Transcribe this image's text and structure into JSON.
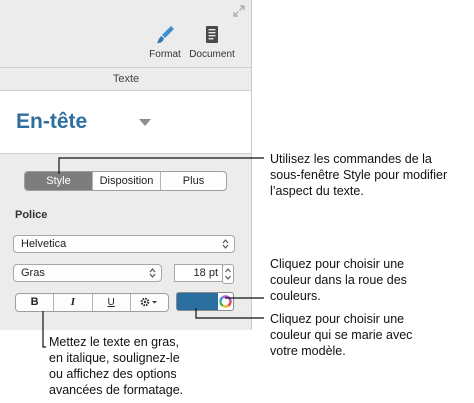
{
  "toolbar": {
    "format_label": "Format",
    "document_label": "Document",
    "format_icon": "paintbrush-icon",
    "document_icon": "document-icon"
  },
  "section": {
    "title": "Texte"
  },
  "paragraph_style": {
    "name": "En-tête"
  },
  "tabs": [
    {
      "label": "Style",
      "active": true
    },
    {
      "label": "Disposition",
      "active": false
    },
    {
      "label": "Plus",
      "active": false
    }
  ],
  "font": {
    "section_label": "Police",
    "family": "Helvetica",
    "typeface": "Gras",
    "size": "18 pt"
  },
  "format_buttons": {
    "bold": "B",
    "italic": "I",
    "underline": "U"
  },
  "text_color": {
    "swatch": "#2b6ea0"
  },
  "callouts": {
    "style_tab": [
      "Utilisez les commandes de la",
      "sous-fenêtre Style pour modifier",
      "l’aspect du texte."
    ],
    "color_wheel": [
      "Cliquez pour choisir une",
      "couleur dans la roue des",
      "couleurs."
    ],
    "color_well": [
      "Cliquez pour choisir une",
      "couleur qui se marie avec",
      "votre modèle."
    ],
    "format_buttons": [
      "Mettez le texte en gras,",
      "en italique, soulignez-le",
      "ou affichez des options",
      "avancées de formatage."
    ]
  },
  "colors": {
    "accent_text": "#2e6f9e",
    "panel_bg": "#ececec"
  }
}
